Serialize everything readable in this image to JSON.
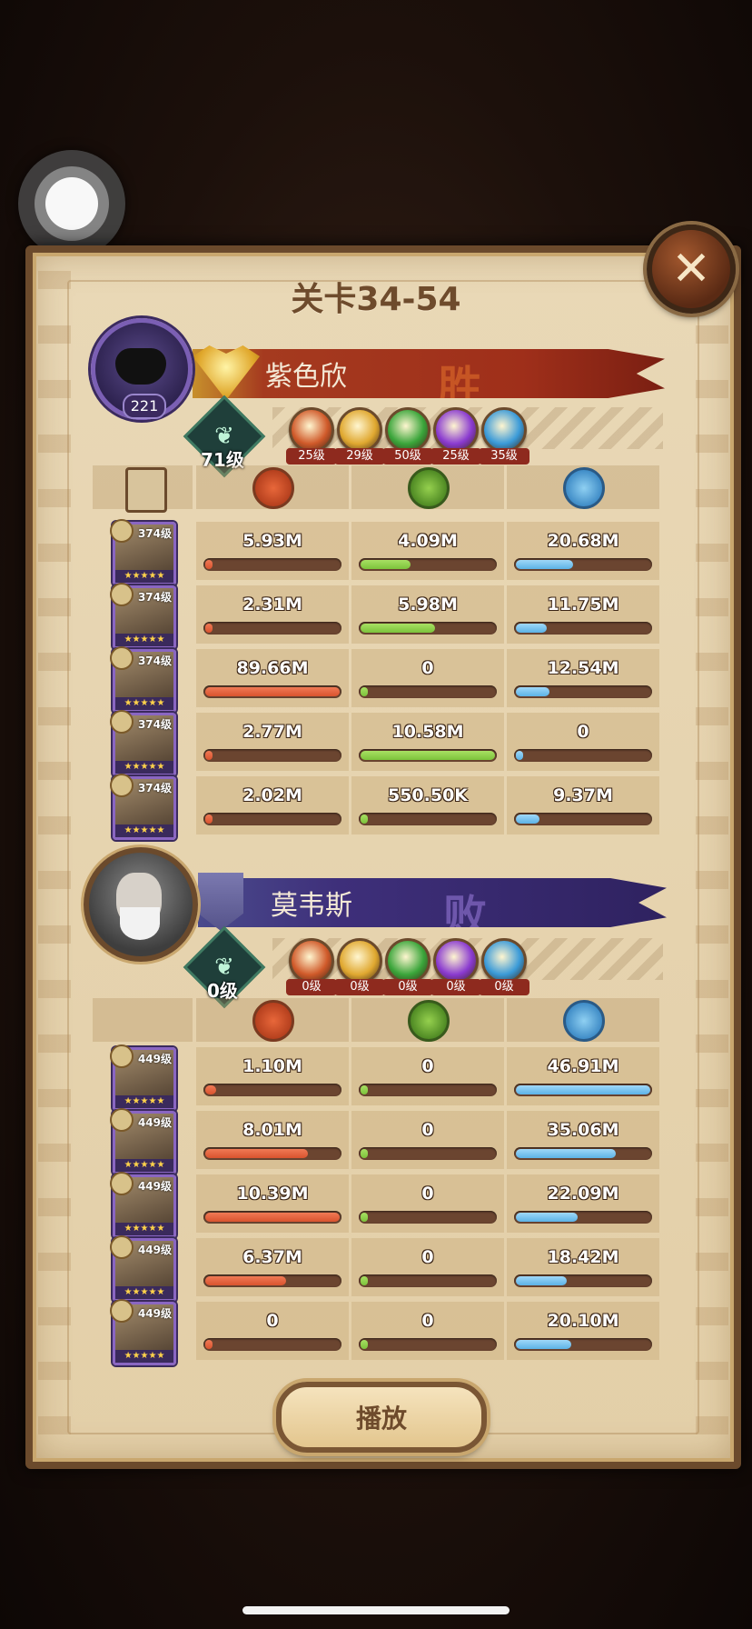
{
  "stage_title": "关卡34-54",
  "close_symbol": "✕",
  "play_label": "播放",
  "icons": {
    "doc": "doc-icon",
    "damage": "damage-icon",
    "heal": "heal-icon",
    "shield": "shield-icon"
  },
  "colors": {
    "damage": "#d9532e",
    "heal": "#7cc23b",
    "shield": "#5cb2e6",
    "win_banner": "#9f2f1a",
    "lose_banner": "#3e2f7a"
  },
  "team1": {
    "name": "紫色欣",
    "result": "胜",
    "avatar_level": "221",
    "tree_level": "71级",
    "factions": [
      {
        "icon": "lightbearer-icon",
        "color": "#d05a2a",
        "level": "25级"
      },
      {
        "icon": "mauler-icon",
        "color": "#e0a830",
        "level": "29级"
      },
      {
        "icon": "wilder-icon",
        "color": "#3aa53a",
        "level": "50级"
      },
      {
        "icon": "graveborn-icon",
        "color": "#8a3ad0",
        "level": "25级"
      },
      {
        "icon": "celestial-icon",
        "color": "#3a9ad8",
        "level": "35级"
      }
    ],
    "heroes": [
      {
        "level": "374级",
        "dmg": "5.93M",
        "heal": "4.09M",
        "shield": "20.68M",
        "dmg_ratio": 0.066,
        "heal_ratio": 0.387,
        "shield_ratio": 0.44
      },
      {
        "level": "374级",
        "dmg": "2.31M",
        "heal": "5.98M",
        "shield": "11.75M",
        "dmg_ratio": 0.026,
        "heal_ratio": 0.565,
        "shield_ratio": 0.25
      },
      {
        "level": "374级",
        "dmg": "89.66M",
        "heal": "0",
        "shield": "12.54M",
        "dmg_ratio": 1.0,
        "heal_ratio": 0.0,
        "shield_ratio": 0.267
      },
      {
        "level": "374级",
        "dmg": "2.77M",
        "heal": "10.58M",
        "shield": "0",
        "dmg_ratio": 0.031,
        "heal_ratio": 1.0,
        "shield_ratio": 0.0
      },
      {
        "level": "374级",
        "dmg": "2.02M",
        "heal": "550.50K",
        "shield": "9.37M",
        "dmg_ratio": 0.023,
        "heal_ratio": 0.052,
        "shield_ratio": 0.2
      }
    ]
  },
  "team2": {
    "name": "莫韦斯",
    "result": "败",
    "tree_level": "0级",
    "factions": [
      {
        "icon": "lightbearer-icon",
        "color": "#d05a2a",
        "level": "0级"
      },
      {
        "icon": "mauler-icon",
        "color": "#e0a830",
        "level": "0级"
      },
      {
        "icon": "wilder-icon",
        "color": "#3aa53a",
        "level": "0级"
      },
      {
        "icon": "graveborn-icon",
        "color": "#8a3ad0",
        "level": "0级"
      },
      {
        "icon": "celestial-icon",
        "color": "#3a9ad8",
        "level": "0级"
      }
    ],
    "heroes": [
      {
        "level": "449级",
        "dmg": "1.10M",
        "heal": "0",
        "shield": "46.91M",
        "dmg_ratio": 0.106,
        "heal_ratio": 0.0,
        "shield_ratio": 1.0
      },
      {
        "level": "449级",
        "dmg": "8.01M",
        "heal": "0",
        "shield": "35.06M",
        "dmg_ratio": 0.771,
        "heal_ratio": 0.0,
        "shield_ratio": 0.747
      },
      {
        "level": "449级",
        "dmg": "10.39M",
        "heal": "0",
        "shield": "22.09M",
        "dmg_ratio": 1.0,
        "heal_ratio": 0.0,
        "shield_ratio": 0.471
      },
      {
        "level": "449级",
        "dmg": "6.37M",
        "heal": "0",
        "shield": "18.42M",
        "dmg_ratio": 0.613,
        "heal_ratio": 0.0,
        "shield_ratio": 0.393
      },
      {
        "level": "449级",
        "dmg": "0",
        "heal": "0",
        "shield": "20.10M",
        "dmg_ratio": 0.0,
        "heal_ratio": 0.0,
        "shield_ratio": 0.428
      }
    ]
  }
}
